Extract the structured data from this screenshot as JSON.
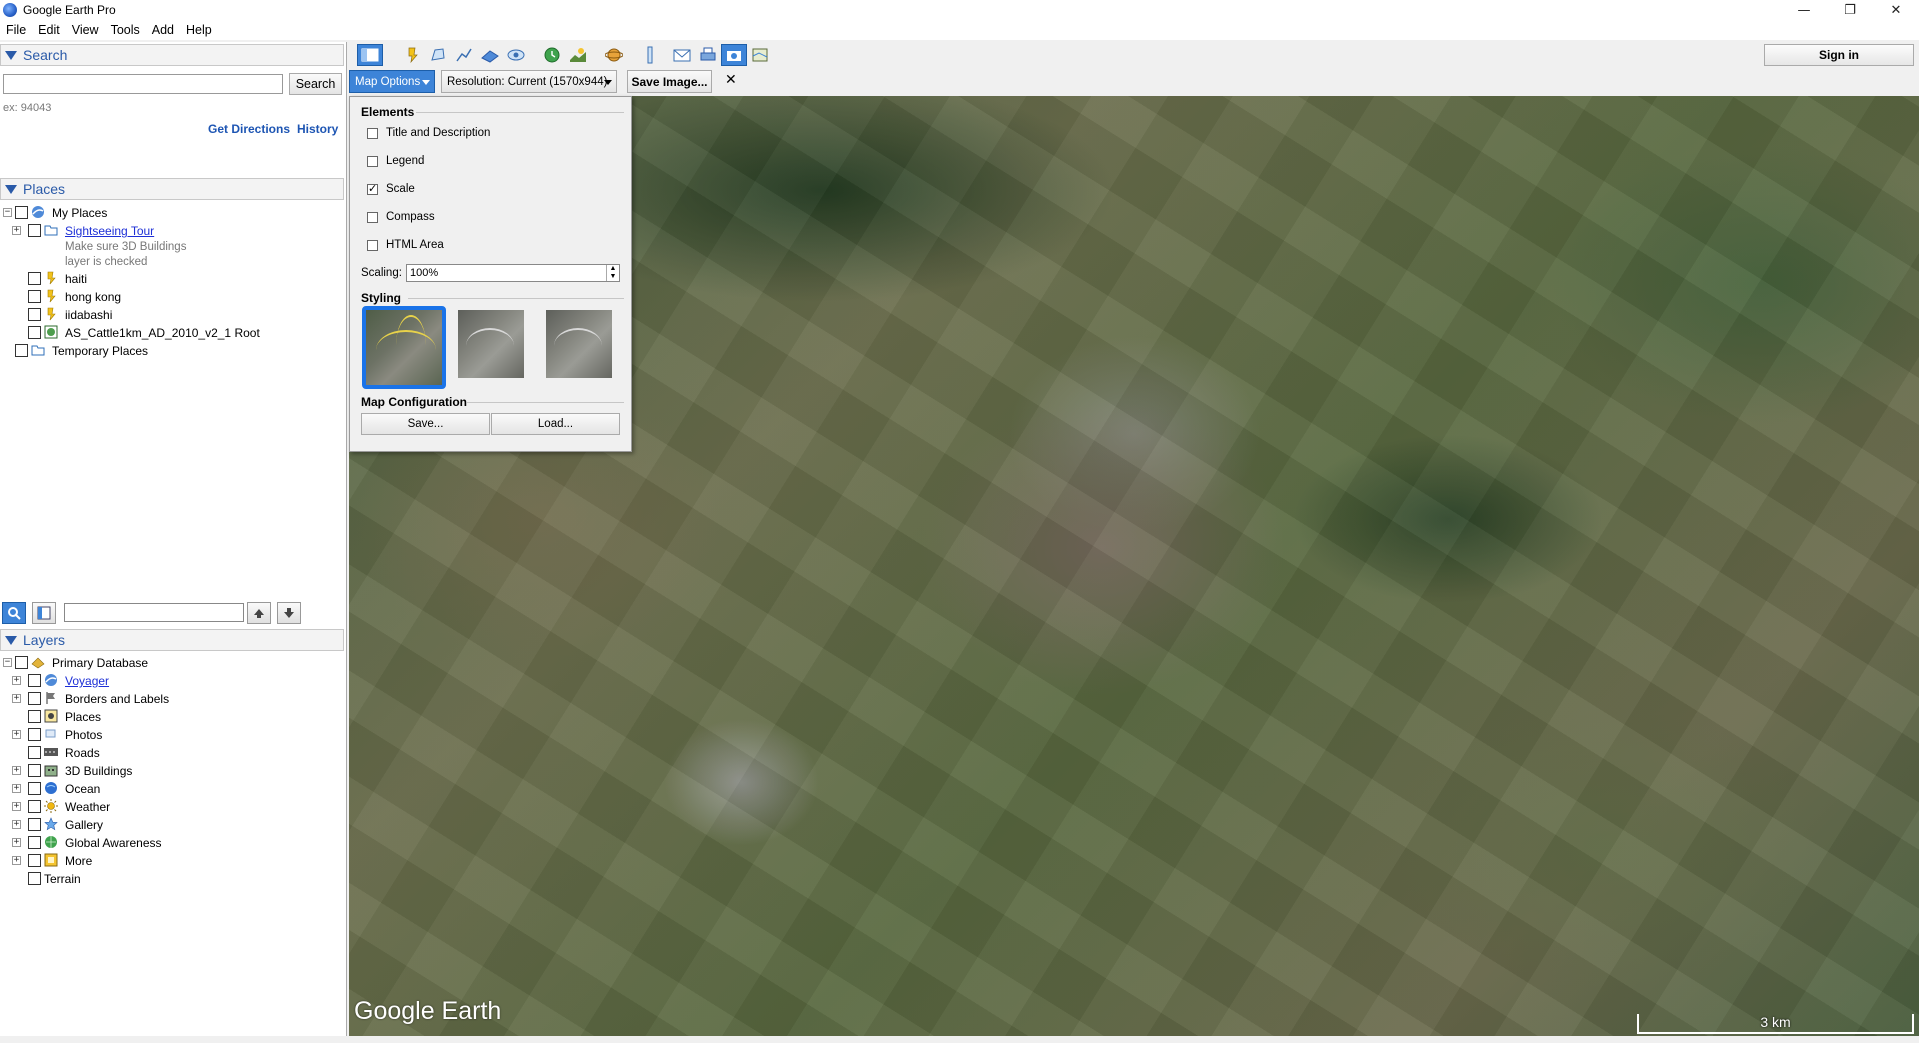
{
  "window": {
    "title": "Google Earth Pro",
    "minimize": "—",
    "maximize": "❐",
    "close": "✕"
  },
  "menu": [
    "File",
    "Edit",
    "View",
    "Tools",
    "Add",
    "Help"
  ],
  "search": {
    "header": "Search",
    "placeholder": "",
    "button": "Search",
    "hint": "ex: 94043",
    "get_directions": "Get Directions",
    "history": "History"
  },
  "places": {
    "header": "Places",
    "items": [
      {
        "label": "My Places"
      },
      {
        "label": "Sightseeing Tour",
        "sub1": "Make sure 3D Buildings",
        "sub2": "layer is checked"
      },
      {
        "label": "haiti"
      },
      {
        "label": "hong kong"
      },
      {
        "label": "iidabashi"
      },
      {
        "label": "AS_Cattle1km_AD_2010_v2_1 Root"
      },
      {
        "label": "Temporary Places"
      }
    ]
  },
  "layers": {
    "header": "Layers",
    "items": [
      {
        "label": "Primary Database"
      },
      {
        "label": "Voyager"
      },
      {
        "label": "Borders and Labels"
      },
      {
        "label": "Places"
      },
      {
        "label": "Photos"
      },
      {
        "label": "Roads"
      },
      {
        "label": "3D Buildings"
      },
      {
        "label": "Ocean"
      },
      {
        "label": "Weather"
      },
      {
        "label": "Gallery"
      },
      {
        "label": "Global Awareness"
      },
      {
        "label": "More"
      },
      {
        "label": "Terrain"
      }
    ]
  },
  "toolbar": {
    "sign_in": "Sign in"
  },
  "savebar": {
    "map_options": "Map Options",
    "resolution": "Resolution: Current (1570x944)",
    "save_image": "Save Image...",
    "close": "✕"
  },
  "map_options": {
    "elements_title": "Elements",
    "elements": [
      {
        "label": "Title and Description",
        "checked": false
      },
      {
        "label": "Legend",
        "checked": false
      },
      {
        "label": "Scale",
        "checked": true
      },
      {
        "label": "Compass",
        "checked": false
      },
      {
        "label": "HTML Area",
        "checked": false
      }
    ],
    "scaling_label": "Scaling:",
    "scaling_value": "100%",
    "styling_title": "Styling",
    "config_title": "Map Configuration",
    "save_btn": "Save...",
    "load_btn": "Load..."
  },
  "map": {
    "logo": "Google Earth",
    "scale": "3 km"
  },
  "colors": {
    "accent": "#3d84d8",
    "link": "#1d55b3",
    "header_text": "#2a5aa8",
    "selection": "#1a73e8"
  }
}
